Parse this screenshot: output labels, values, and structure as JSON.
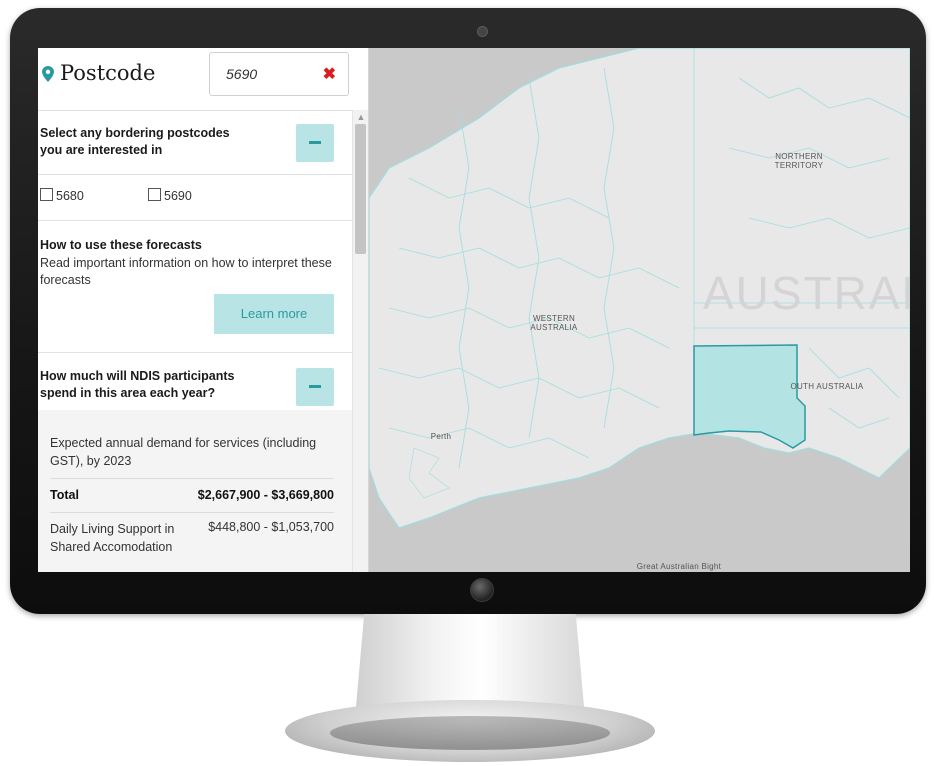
{
  "postcode": {
    "title": "Postcode",
    "value": "5690",
    "clear_symbol": "✖"
  },
  "bordering": {
    "title_line1": "Select any bordering postcodes",
    "title_line2": "you are interested in",
    "options": [
      {
        "label": "5680",
        "checked": false
      },
      {
        "label": "5690",
        "checked": false
      }
    ]
  },
  "help": {
    "title": "How to use these forecasts",
    "text": "Read important information on how to interpret these forecasts",
    "button": "Learn more"
  },
  "spend": {
    "title_line1": "How much will NDIS participants",
    "title_line2": "spend in this area each year?",
    "description": "Expected annual demand for services (including GST), by 2023",
    "total_label": "Total",
    "total_value": "$2,667,900 - $3,669,800",
    "rows": [
      {
        "label": "Daily Living Support in Shared Accomodation",
        "value": "$448,800 - $1,053,700"
      }
    ]
  },
  "map": {
    "labels": {
      "nt": "NORTHERN TERRITORY",
      "wa": "WESTERN AUSTRALIA",
      "sa": "OUTH AUSTRALIA",
      "australia": "AUSTRALI",
      "bight": "Great Australian Bight",
      "perth": "Perth"
    },
    "colors": {
      "land": "#e8e8e8",
      "sea": "#c9c9c9",
      "boundary": "#9fdde0",
      "highlight": "#b4e3e4",
      "highlight_border": "#2a9aa1"
    }
  },
  "icons": {
    "pin": "map-pin-icon",
    "minus": "minus-icon",
    "clear": "close-icon"
  }
}
